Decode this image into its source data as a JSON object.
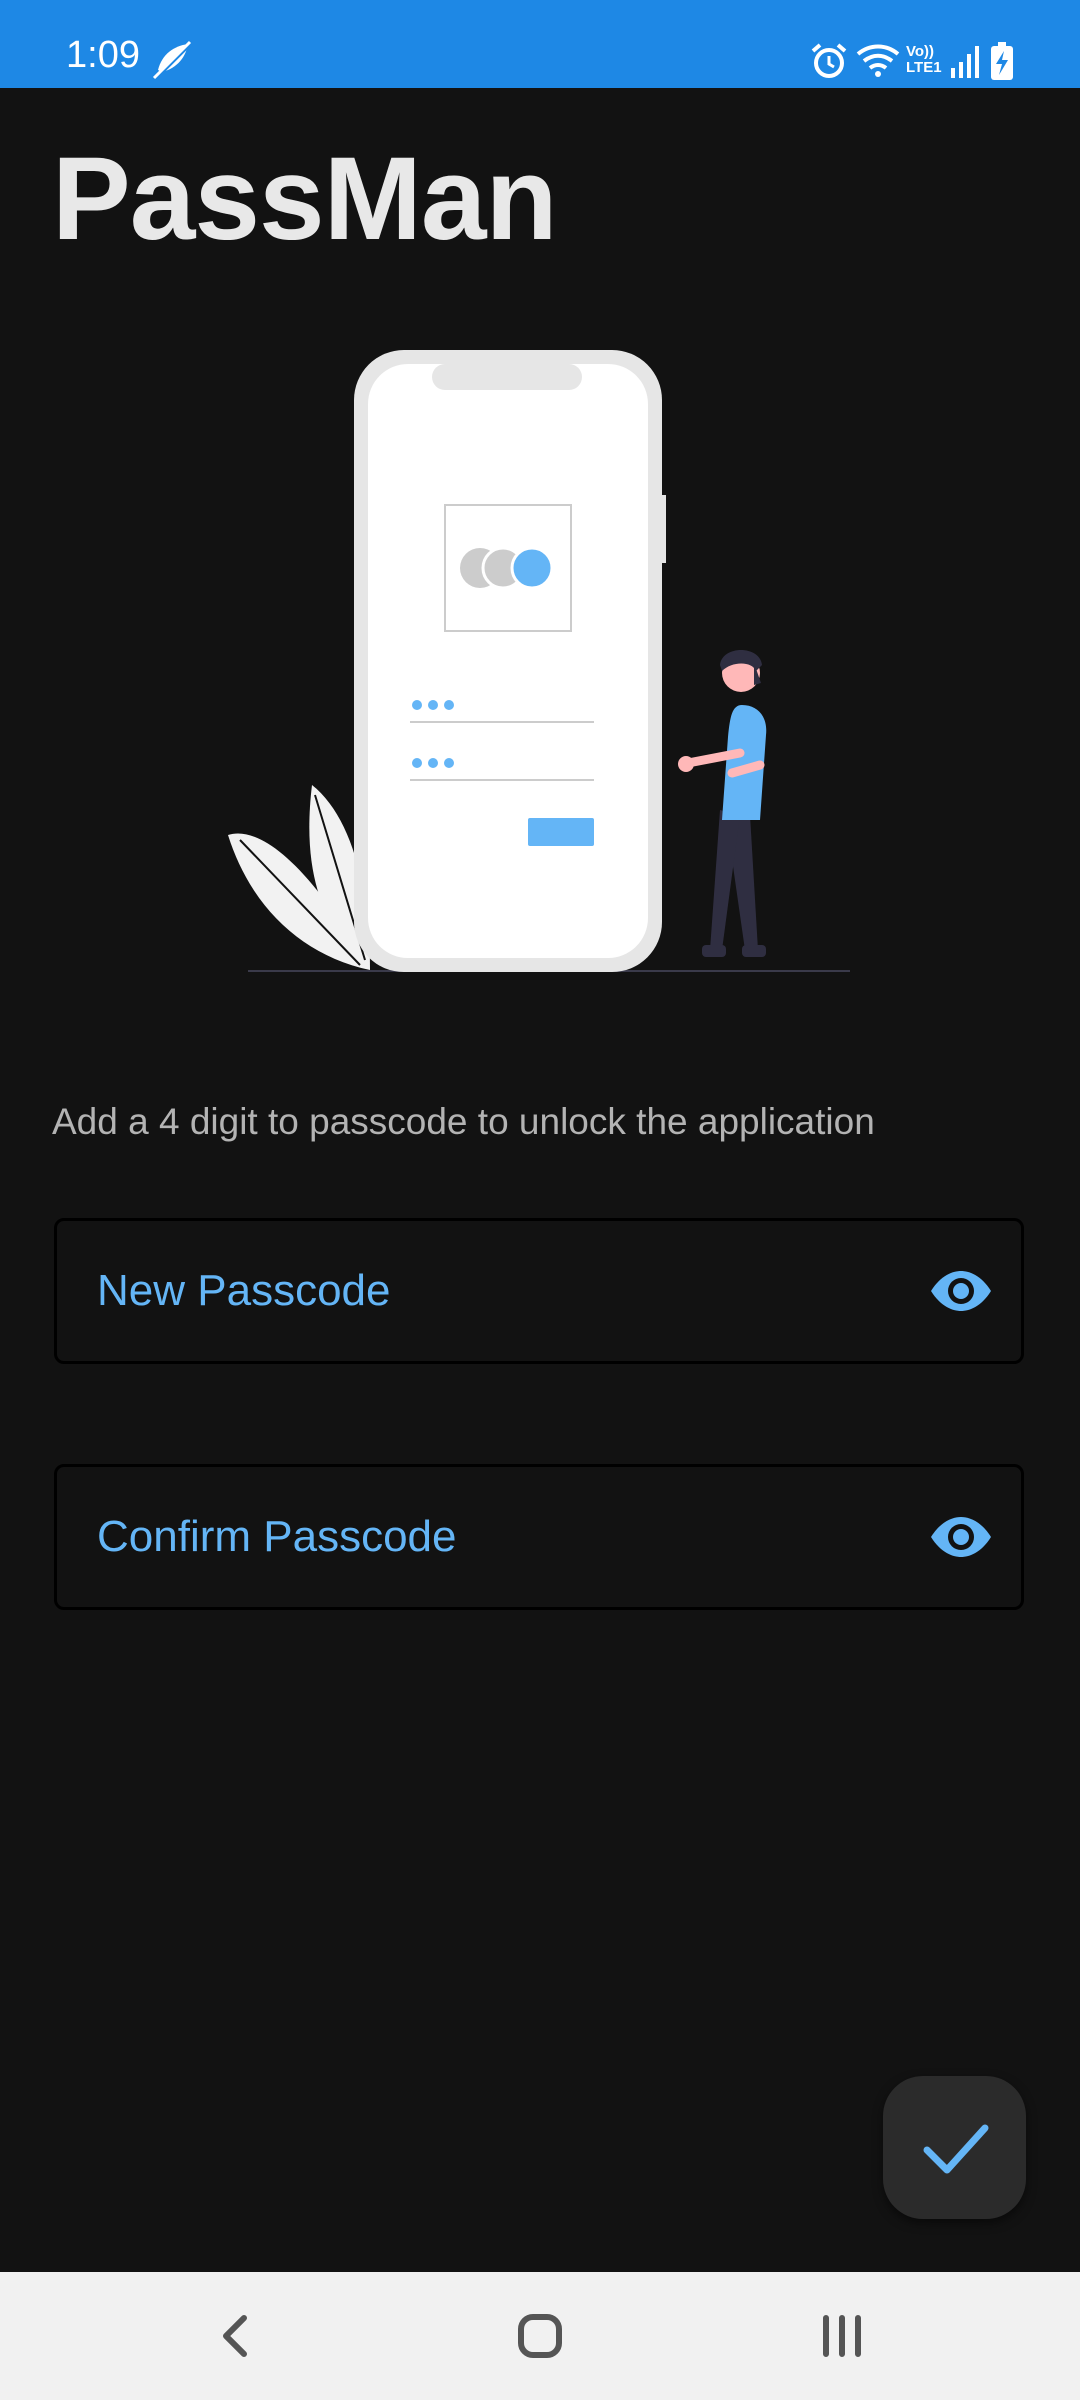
{
  "status_bar": {
    "time": "1:09",
    "icons": [
      "wifi-off-call-icon",
      "alarm-icon",
      "wifi-icon",
      "volte-lte-icon",
      "signal-icon",
      "battery-charging-icon"
    ],
    "volte_line1": "Vo))",
    "volte_line2": "LTE1"
  },
  "app": {
    "title": "PassMan"
  },
  "illustration": {
    "icon": "phone-login-person-illustration"
  },
  "instruction": "Add a 4 digit to passcode to unlock the application",
  "fields": {
    "new_passcode": {
      "label": "New Passcode",
      "value": "",
      "toggle_icon": "eye-icon"
    },
    "confirm_passcode": {
      "label": "Confirm Passcode",
      "value": "",
      "toggle_icon": "eye-icon"
    }
  },
  "fab": {
    "icon": "check-icon"
  },
  "nav_bar": {
    "icons": [
      "back-icon",
      "home-icon",
      "recents-icon"
    ]
  },
  "colors": {
    "status_bar": "#1e88e5",
    "background": "#121212",
    "accent": "#64b5f6",
    "title": "#e8e8e8",
    "instruction": "#b3b3b3",
    "nav_bar": "#f1f1f1"
  }
}
